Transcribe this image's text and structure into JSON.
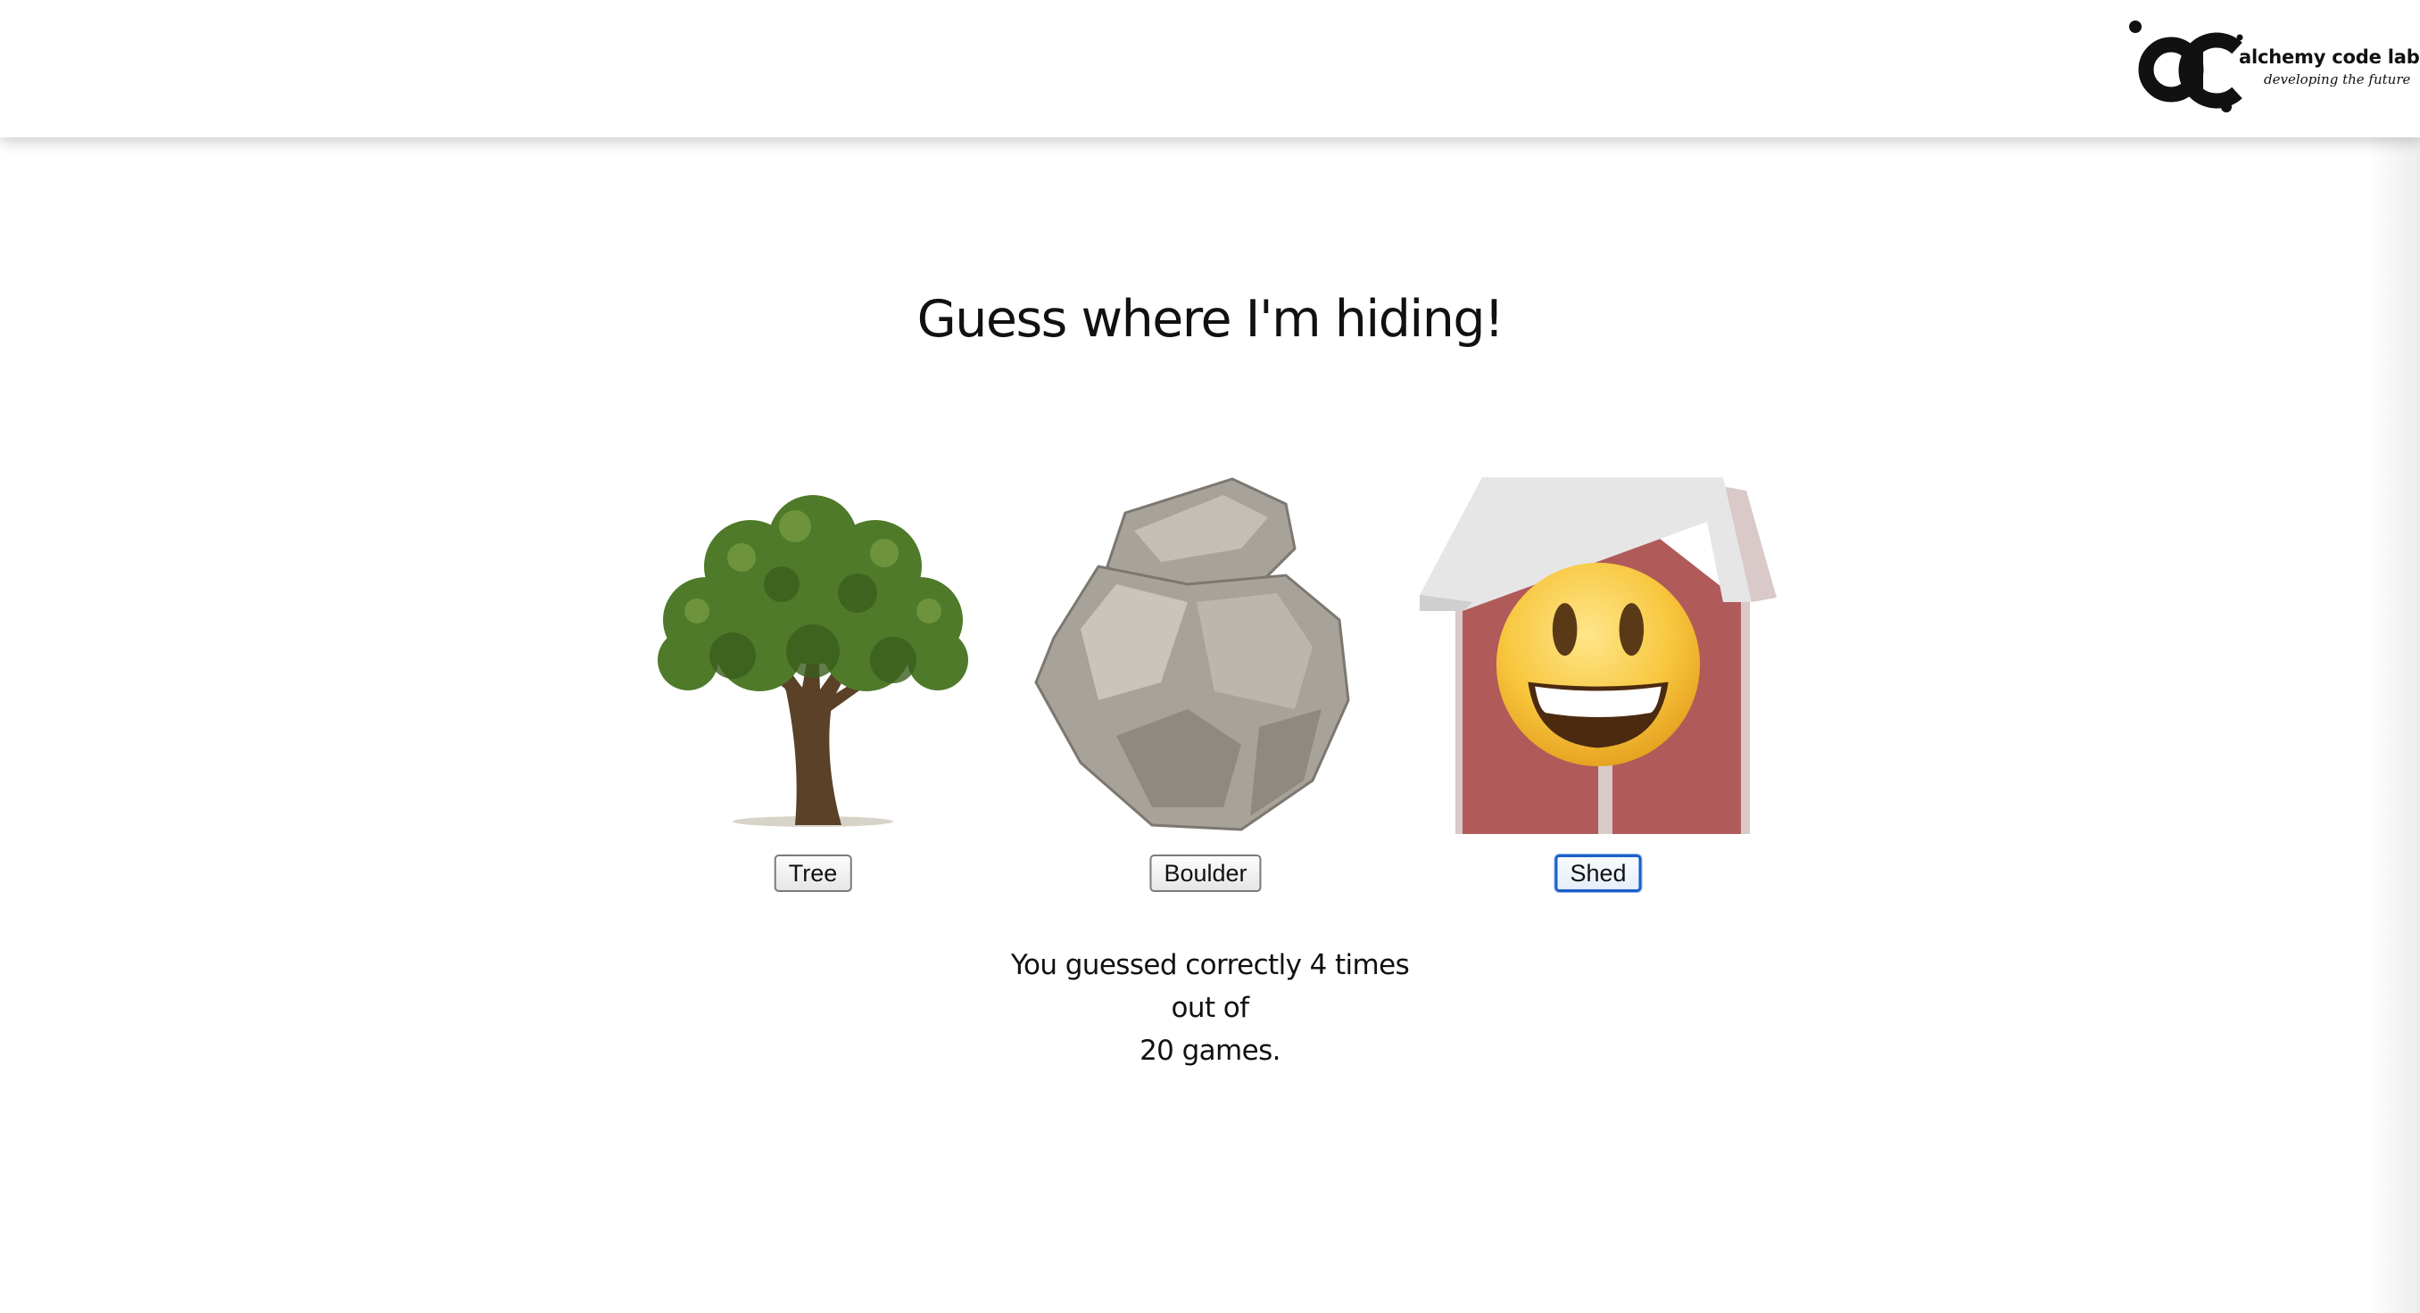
{
  "header": {
    "logo": {
      "name": "alchemy code lab",
      "tagline": "developing the future"
    }
  },
  "game": {
    "title": "Guess where I'm hiding!",
    "spots": [
      {
        "id": "tree",
        "label": "Tree",
        "image": "tree-image",
        "has_emoji": false,
        "focused": false
      },
      {
        "id": "boulder",
        "label": "Boulder",
        "image": "boulder-image",
        "has_emoji": false,
        "focused": false
      },
      {
        "id": "shed",
        "label": "Shed",
        "image": "shed-image",
        "has_emoji": true,
        "emoji": "smiley-face",
        "focused": true
      }
    ],
    "score": {
      "line1_prefix": "You guessed correctly ",
      "correct": "4",
      "line1_suffix": " times",
      "line2": "out of",
      "total": "20",
      "line3_suffix": " games."
    }
  },
  "colors": {
    "shed_wall": "#b05a5a",
    "shed_roof": "#e6e6e6",
    "boulder": "#a7a29a",
    "tree_foliage": "#4f7a2a",
    "tree_trunk": "#5b4128",
    "focus_ring": "#1a5fc7",
    "emoji_face": "#f5c43a"
  }
}
